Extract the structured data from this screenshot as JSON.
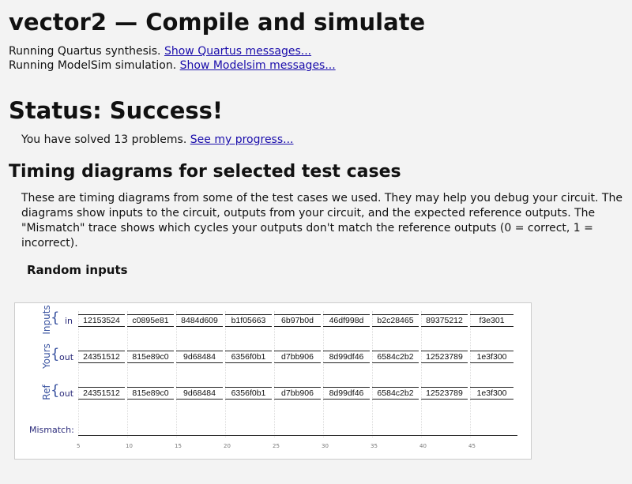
{
  "title": "vector2 — Compile and simulate",
  "quartus_text": "Running Quartus synthesis.",
  "quartus_link": "Show Quartus messages...",
  "modelsim_text": "Running ModelSim simulation.",
  "modelsim_link": "Show Modelsim messages...",
  "status": "Status: Success!",
  "solved_text": "You have solved 13 problems.",
  "progress_link": "See my progress...",
  "timing_heading": "Timing diagrams for selected test cases",
  "description": "These are timing diagrams from some of the test cases we used. They may help you debug your circuit. The diagrams show inputs to the circuit, outputs from your circuit, and the expected reference outputs. The \"Mismatch\" trace shows which cycles your outputs don't match the reference outputs (0 = correct, 1 = incorrect).",
  "section_title": "Random inputs",
  "groups": {
    "inputs_label": "Inputs",
    "yours_label": "Yours",
    "ref_label": "Ref"
  },
  "signals": {
    "in_label": "in",
    "out_label": "out",
    "mismatch_label": "Mismatch:"
  },
  "in_values": [
    "12153524",
    "c0895e81",
    "8484d609",
    "b1f05663",
    "6b97b0d",
    "46df998d",
    "b2c28465",
    "89375212",
    "f3e301"
  ],
  "yours_values": [
    "24351512",
    "815e89c0",
    "9d68484",
    "6356f0b1",
    "d7bb906",
    "8d99df46",
    "6584c2b2",
    "12523789",
    "1e3f300"
  ],
  "ref_values": [
    "24351512",
    "815e89c0",
    "9d68484",
    "6356f0b1",
    "d7bb906",
    "8d99df46",
    "6584c2b2",
    "12523789",
    "1e3f300"
  ],
  "ticks": [
    "5",
    "10",
    "15",
    "20",
    "25",
    "30",
    "35",
    "40",
    "45"
  ]
}
